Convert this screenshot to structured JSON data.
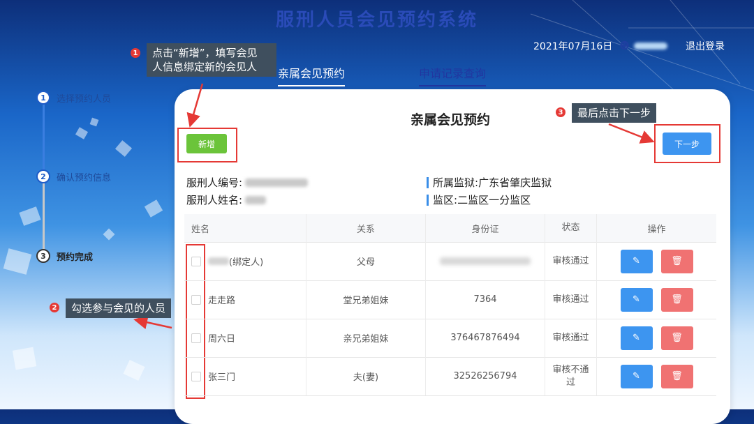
{
  "header": {
    "system_title": "服刑人员会见预约系统",
    "date": "2021年07月16日",
    "logout": "退出登录"
  },
  "tabs": [
    {
      "label": "亲属会见预约",
      "active": true
    },
    {
      "label": "申请记录查询",
      "active": false
    }
  ],
  "steps": [
    {
      "num": "1",
      "label": "选择预约人员"
    },
    {
      "num": "2",
      "label": "确认预约信息"
    },
    {
      "num": "3",
      "label": "预约完成"
    }
  ],
  "card": {
    "title": "亲属会见预约",
    "add_button": "新增",
    "next_button": "下一步",
    "inmate_id_label": "服刑人编号:",
    "inmate_name_label": "服刑人姓名:",
    "prison_label": "所属监狱:",
    "prison_value": "广东省肇庆监狱",
    "area_label": "监区:",
    "area_value": "二监区一分监区"
  },
  "table": {
    "headers": [
      "姓名",
      "关系",
      "身份证",
      "状态",
      "操作"
    ],
    "rows": [
      {
        "name": "(绑定人)",
        "relation": "父母",
        "id": "",
        "status": "审核通过"
      },
      {
        "name": "走走路",
        "relation": "堂兄弟姐妹",
        "id": "7364",
        "status": "审核通过"
      },
      {
        "name": "周六日",
        "relation": "亲兄弟姐妹",
        "id": "376467876494",
        "status": "审核通过"
      },
      {
        "name": "张三门",
        "relation": "夫(妻)",
        "id": "32526256794",
        "status": "审核不通过"
      }
    ]
  },
  "annotations": {
    "c1_num": "1",
    "c1_text_line1": "点击“新增”，填写会见",
    "c1_text_line2": "人信息绑定新的会见人",
    "c2_num": "2",
    "c2_text": "勾选参与会见的人员",
    "c3_num": "3",
    "c3_text": "最后点击下一步"
  },
  "icons": {
    "user": "user-icon",
    "edit": "pencil-icon",
    "delete": "trash-icon"
  },
  "colors": {
    "primary": "#3d95f0",
    "add": "#6bc43a",
    "delete": "#f07272",
    "highlight": "#e53935"
  }
}
